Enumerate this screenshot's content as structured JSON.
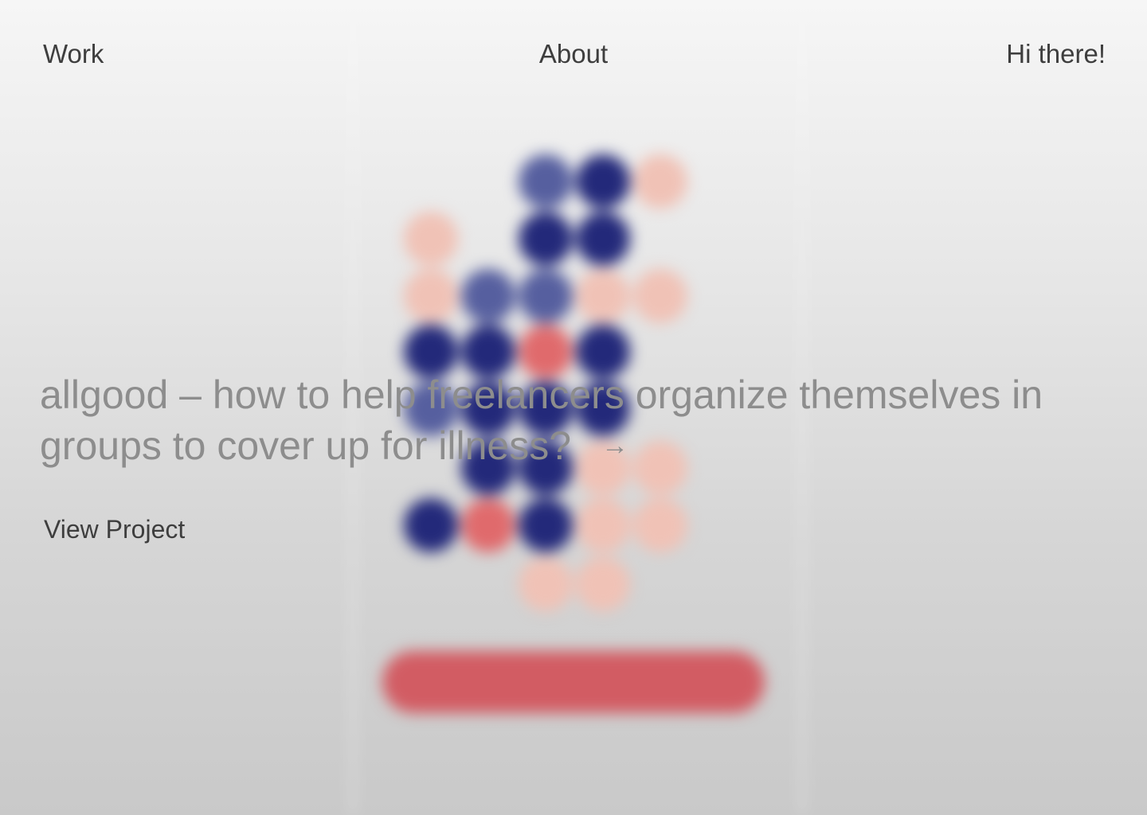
{
  "nav": {
    "work": "Work",
    "about": "About",
    "greeting": "Hi there!"
  },
  "hero": {
    "headline": "allgood – how to help freelancers organize themselves in groups to cover up for illness?",
    "arrow": "→",
    "view_project": "View Project"
  },
  "colors": {
    "dot_navy": "#23297a",
    "dot_slate": "#565f9f",
    "dot_peach": "#f0c2b6",
    "dot_coral": "#e06a6c",
    "cta_red": "#d25c63"
  }
}
